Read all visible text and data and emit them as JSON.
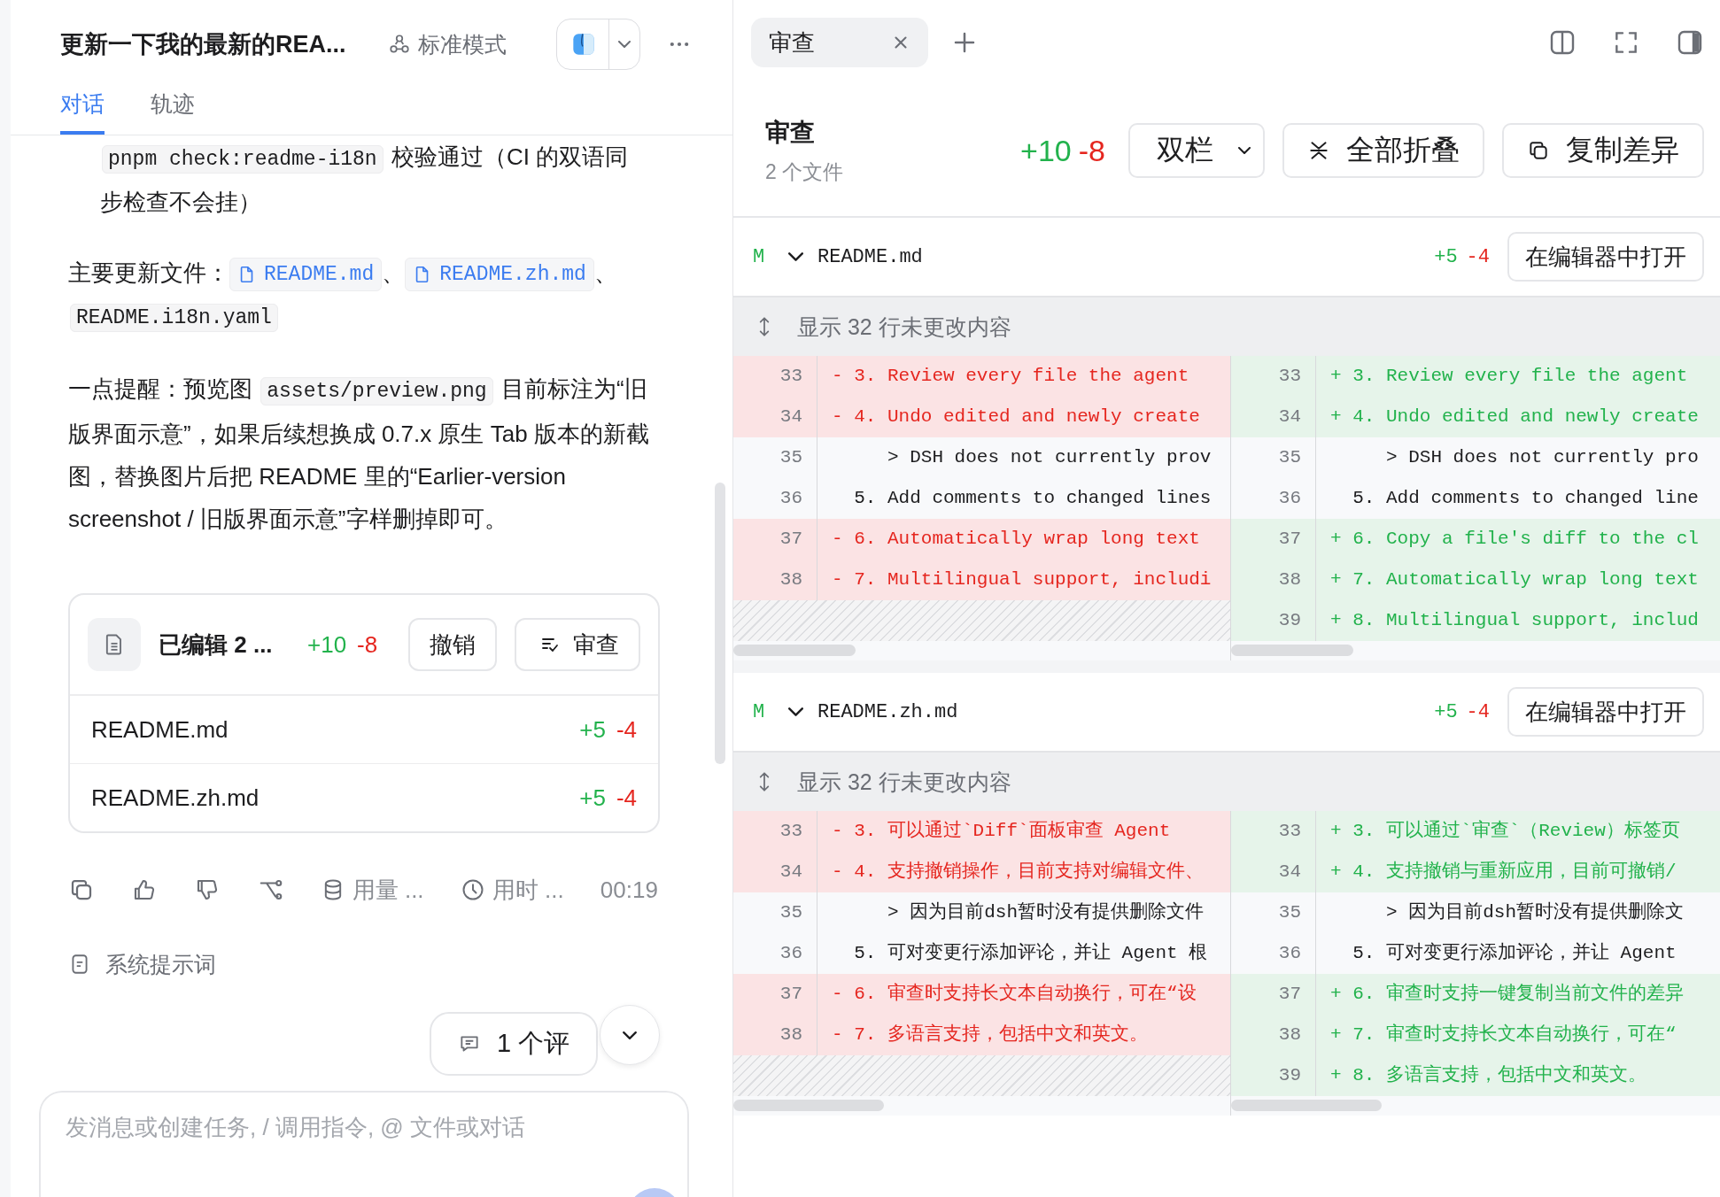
{
  "conversation": {
    "title": "更新一下我的最新的REA...",
    "mode": "标准模式",
    "tabs": [
      {
        "label": "对话",
        "selected": true
      },
      {
        "label": "轨迹",
        "selected": false
      }
    ],
    "paragraphs": [
      {
        "indented": true,
        "segments": [
          {
            "kind": "code",
            "text": "pnpm check:readme-i18n"
          },
          {
            "kind": "text",
            "text": " 校验通过（CI 的双语同步检查不会挂）"
          }
        ]
      },
      {
        "indented": false,
        "segments": [
          {
            "kind": "text",
            "text": "主要更新文件："
          },
          {
            "kind": "file",
            "text": "README.md"
          },
          {
            "kind": "text",
            "text": "、"
          },
          {
            "kind": "file",
            "text": "README.zh.md"
          },
          {
            "kind": "text",
            "text": "、"
          },
          {
            "kind": "code",
            "text": "README.i18n.yaml"
          }
        ]
      },
      {
        "indented": false,
        "segments": [
          {
            "kind": "text",
            "text": "一点提醒：预览图 "
          },
          {
            "kind": "code",
            "text": "assets/preview.png"
          },
          {
            "kind": "text",
            "text": " 目前标注为“旧版界面示意”，如果后续想换成 0.7.x 原生 Tab 版本的新截图，替换图片后把 README 里的“Earlier-version screenshot / 旧版界面示意”字样删掉即可。"
          }
        ]
      }
    ],
    "changes_card": {
      "title": "已编辑 2 ...",
      "added": "+10",
      "removed": "-8",
      "buttons": [
        {
          "label": "撤销",
          "kind": "undo"
        },
        {
          "label": "审查",
          "kind": "review"
        }
      ],
      "files": [
        {
          "name": "README.md",
          "added": "+5",
          "removed": "-4"
        },
        {
          "name": "README.zh.md",
          "added": "+5",
          "removed": "-4"
        }
      ]
    },
    "stats": {
      "usage": "用量 ...",
      "duration": "用时 ...",
      "time": "00:19"
    },
    "system_prompt": "系统提示词",
    "comments_pill": "1 个评",
    "input": {
      "placeholder": "发消息或创建任务, / 调用指令, @ 文件或对话"
    }
  },
  "review": {
    "tabs": [
      {
        "label": "审查",
        "selected": true
      }
    ],
    "title": "审查",
    "subtitle": "2 个文件",
    "added": "+10",
    "removed": "-8",
    "view_select": "双栏",
    "collapse_button": "全部折叠",
    "copy_button": "复制差异",
    "files": [
      {
        "status": "M",
        "name": "README.md",
        "added": "+5",
        "removed": "-4",
        "open_button": "在编辑器中打开",
        "expand": "显示 32 行未更改内容",
        "left": [
          {
            "num": "33",
            "kind": "removed",
            "text": "- 3. Review every file the agent"
          },
          {
            "num": "34",
            "kind": "removed",
            "text": "- 4. Undo edited and newly create"
          },
          {
            "num": "35",
            "kind": "context",
            "text": "     > DSH does not currently prov"
          },
          {
            "num": "36",
            "kind": "context",
            "text": "  5. Add comments to changed lines"
          },
          {
            "num": "37",
            "kind": "removed",
            "text": "- 6. Automatically wrap long text"
          },
          {
            "num": "38",
            "kind": "removed",
            "text": "- 7. Multilingual support, includi"
          }
        ],
        "right": [
          {
            "num": "33",
            "kind": "added",
            "text": "+ 3. Review every file the agent"
          },
          {
            "num": "34",
            "kind": "added",
            "text": "+ 4. Undo edited and newly create"
          },
          {
            "num": "35",
            "kind": "context",
            "text": "     > DSH does not currently pro"
          },
          {
            "num": "36",
            "kind": "context",
            "text": "  5. Add comments to changed line"
          },
          {
            "num": "37",
            "kind": "added",
            "text": "+ 6. Copy a file's diff to the cl"
          },
          {
            "num": "38",
            "kind": "added",
            "text": "+ 7. Automatically wrap long text"
          },
          {
            "num": "39",
            "kind": "added",
            "text": "+ 8. Multilingual support, includ"
          }
        ]
      },
      {
        "status": "M",
        "name": "README.zh.md",
        "added": "+5",
        "removed": "-4",
        "open_button": "在编辑器中打开",
        "expand": "显示 32 行未更改内容",
        "left": [
          {
            "num": "33",
            "kind": "removed",
            "text": "- 3. 可以通过`Diff`面板审查 Agent"
          },
          {
            "num": "34",
            "kind": "removed",
            "text": "- 4. 支持撤销操作，目前支持对编辑文件、"
          },
          {
            "num": "35",
            "kind": "context",
            "text": "     > 因为目前dsh暂时没有提供删除文件"
          },
          {
            "num": "36",
            "kind": "context",
            "text": "  5. 可对变更行添加评论，并让 Agent 根"
          },
          {
            "num": "37",
            "kind": "removed",
            "text": "- 6. 审查时支持长文本自动换行，可在“设"
          },
          {
            "num": "38",
            "kind": "removed",
            "text": "- 7. 多语言支持，包括中文和英文。"
          }
        ],
        "right": [
          {
            "num": "33",
            "kind": "added",
            "text": "+ 3. 可以通过`审查`（Review）标签页"
          },
          {
            "num": "34",
            "kind": "added",
            "text": "+ 4. 支持撤销与重新应用，目前可撤销/"
          },
          {
            "num": "35",
            "kind": "context",
            "text": "     > 因为目前dsh暂时没有提供删除文"
          },
          {
            "num": "36",
            "kind": "context",
            "text": "  5. 可对变更行添加评论，并让 Agent"
          },
          {
            "num": "37",
            "kind": "added",
            "text": "+ 6. 审查时支持一键复制当前文件的差异"
          },
          {
            "num": "38",
            "kind": "added",
            "text": "+ 7. 审查时支持长文本自动换行，可在“"
          },
          {
            "num": "39",
            "kind": "added",
            "text": "+ 8. 多语言支持，包括中文和英文。"
          }
        ]
      }
    ]
  }
}
